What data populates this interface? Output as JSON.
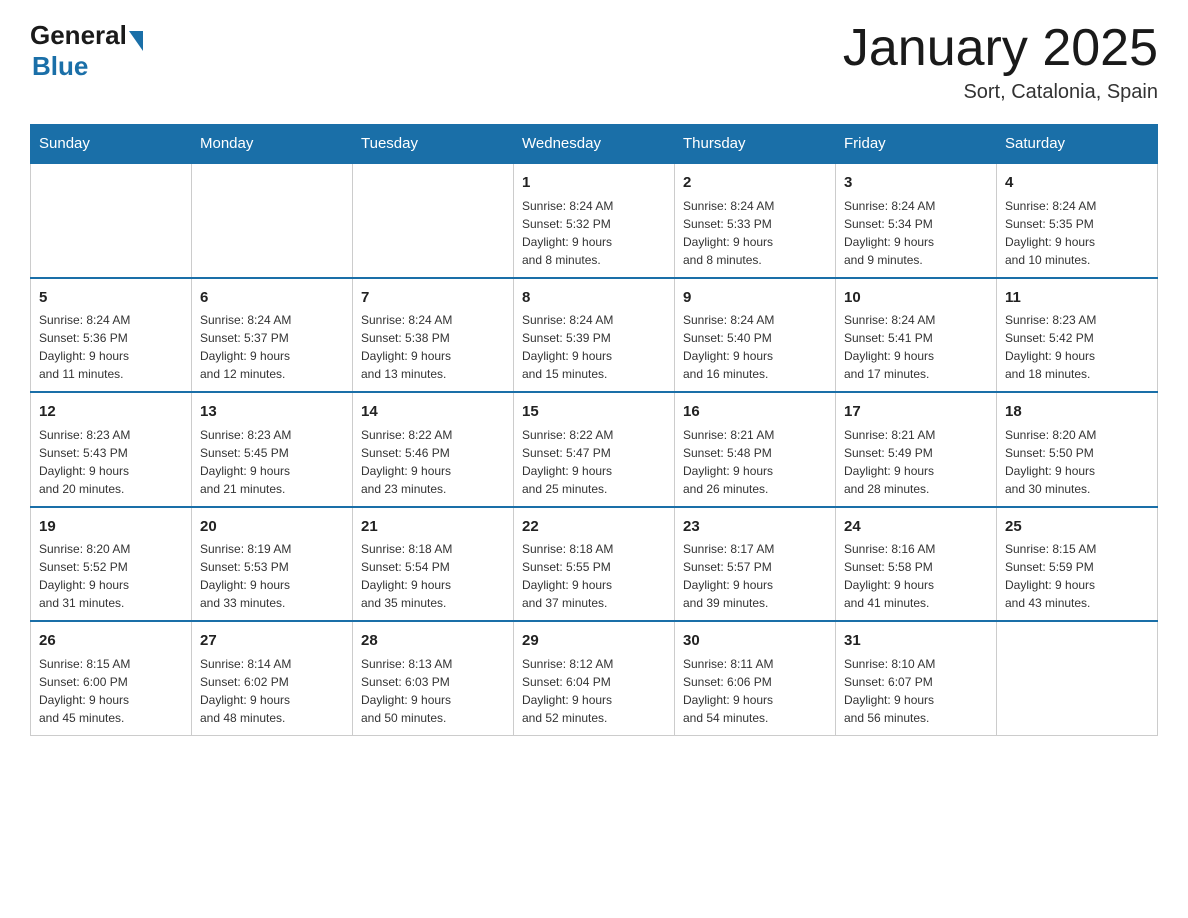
{
  "header": {
    "logo_general": "General",
    "logo_blue": "Blue",
    "title": "January 2025",
    "subtitle": "Sort, Catalonia, Spain"
  },
  "weekdays": [
    "Sunday",
    "Monday",
    "Tuesday",
    "Wednesday",
    "Thursday",
    "Friday",
    "Saturday"
  ],
  "weeks": [
    [
      {
        "day": "",
        "info": ""
      },
      {
        "day": "",
        "info": ""
      },
      {
        "day": "",
        "info": ""
      },
      {
        "day": "1",
        "info": "Sunrise: 8:24 AM\nSunset: 5:32 PM\nDaylight: 9 hours\nand 8 minutes."
      },
      {
        "day": "2",
        "info": "Sunrise: 8:24 AM\nSunset: 5:33 PM\nDaylight: 9 hours\nand 8 minutes."
      },
      {
        "day": "3",
        "info": "Sunrise: 8:24 AM\nSunset: 5:34 PM\nDaylight: 9 hours\nand 9 minutes."
      },
      {
        "day": "4",
        "info": "Sunrise: 8:24 AM\nSunset: 5:35 PM\nDaylight: 9 hours\nand 10 minutes."
      }
    ],
    [
      {
        "day": "5",
        "info": "Sunrise: 8:24 AM\nSunset: 5:36 PM\nDaylight: 9 hours\nand 11 minutes."
      },
      {
        "day": "6",
        "info": "Sunrise: 8:24 AM\nSunset: 5:37 PM\nDaylight: 9 hours\nand 12 minutes."
      },
      {
        "day": "7",
        "info": "Sunrise: 8:24 AM\nSunset: 5:38 PM\nDaylight: 9 hours\nand 13 minutes."
      },
      {
        "day": "8",
        "info": "Sunrise: 8:24 AM\nSunset: 5:39 PM\nDaylight: 9 hours\nand 15 minutes."
      },
      {
        "day": "9",
        "info": "Sunrise: 8:24 AM\nSunset: 5:40 PM\nDaylight: 9 hours\nand 16 minutes."
      },
      {
        "day": "10",
        "info": "Sunrise: 8:24 AM\nSunset: 5:41 PM\nDaylight: 9 hours\nand 17 minutes."
      },
      {
        "day": "11",
        "info": "Sunrise: 8:23 AM\nSunset: 5:42 PM\nDaylight: 9 hours\nand 18 minutes."
      }
    ],
    [
      {
        "day": "12",
        "info": "Sunrise: 8:23 AM\nSunset: 5:43 PM\nDaylight: 9 hours\nand 20 minutes."
      },
      {
        "day": "13",
        "info": "Sunrise: 8:23 AM\nSunset: 5:45 PM\nDaylight: 9 hours\nand 21 minutes."
      },
      {
        "day": "14",
        "info": "Sunrise: 8:22 AM\nSunset: 5:46 PM\nDaylight: 9 hours\nand 23 minutes."
      },
      {
        "day": "15",
        "info": "Sunrise: 8:22 AM\nSunset: 5:47 PM\nDaylight: 9 hours\nand 25 minutes."
      },
      {
        "day": "16",
        "info": "Sunrise: 8:21 AM\nSunset: 5:48 PM\nDaylight: 9 hours\nand 26 minutes."
      },
      {
        "day": "17",
        "info": "Sunrise: 8:21 AM\nSunset: 5:49 PM\nDaylight: 9 hours\nand 28 minutes."
      },
      {
        "day": "18",
        "info": "Sunrise: 8:20 AM\nSunset: 5:50 PM\nDaylight: 9 hours\nand 30 minutes."
      }
    ],
    [
      {
        "day": "19",
        "info": "Sunrise: 8:20 AM\nSunset: 5:52 PM\nDaylight: 9 hours\nand 31 minutes."
      },
      {
        "day": "20",
        "info": "Sunrise: 8:19 AM\nSunset: 5:53 PM\nDaylight: 9 hours\nand 33 minutes."
      },
      {
        "day": "21",
        "info": "Sunrise: 8:18 AM\nSunset: 5:54 PM\nDaylight: 9 hours\nand 35 minutes."
      },
      {
        "day": "22",
        "info": "Sunrise: 8:18 AM\nSunset: 5:55 PM\nDaylight: 9 hours\nand 37 minutes."
      },
      {
        "day": "23",
        "info": "Sunrise: 8:17 AM\nSunset: 5:57 PM\nDaylight: 9 hours\nand 39 minutes."
      },
      {
        "day": "24",
        "info": "Sunrise: 8:16 AM\nSunset: 5:58 PM\nDaylight: 9 hours\nand 41 minutes."
      },
      {
        "day": "25",
        "info": "Sunrise: 8:15 AM\nSunset: 5:59 PM\nDaylight: 9 hours\nand 43 minutes."
      }
    ],
    [
      {
        "day": "26",
        "info": "Sunrise: 8:15 AM\nSunset: 6:00 PM\nDaylight: 9 hours\nand 45 minutes."
      },
      {
        "day": "27",
        "info": "Sunrise: 8:14 AM\nSunset: 6:02 PM\nDaylight: 9 hours\nand 48 minutes."
      },
      {
        "day": "28",
        "info": "Sunrise: 8:13 AM\nSunset: 6:03 PM\nDaylight: 9 hours\nand 50 minutes."
      },
      {
        "day": "29",
        "info": "Sunrise: 8:12 AM\nSunset: 6:04 PM\nDaylight: 9 hours\nand 52 minutes."
      },
      {
        "day": "30",
        "info": "Sunrise: 8:11 AM\nSunset: 6:06 PM\nDaylight: 9 hours\nand 54 minutes."
      },
      {
        "day": "31",
        "info": "Sunrise: 8:10 AM\nSunset: 6:07 PM\nDaylight: 9 hours\nand 56 minutes."
      },
      {
        "day": "",
        "info": ""
      }
    ]
  ]
}
